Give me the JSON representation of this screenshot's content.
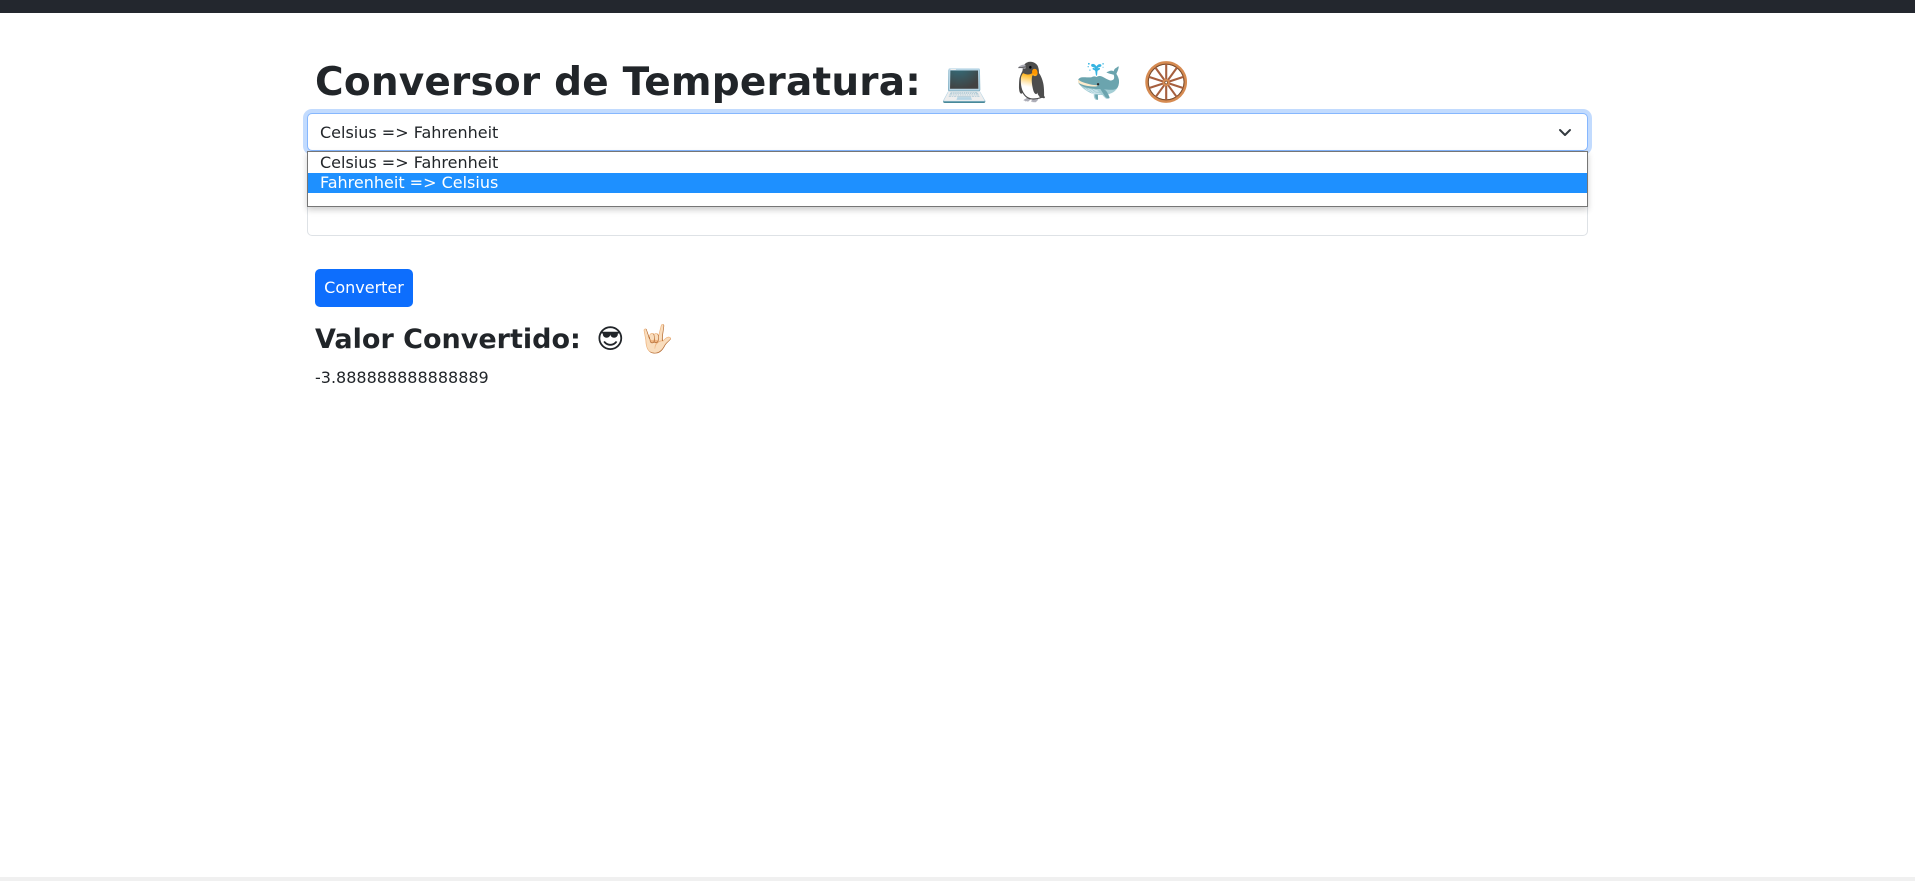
{
  "header": {
    "title": "Conversor de Temperatura:",
    "emojis": [
      "💻",
      "🐧",
      "🐳",
      "🛞"
    ]
  },
  "converter": {
    "select": {
      "value": "Celsius => Fahrenheit",
      "options": [
        "Celsius => Fahrenheit",
        "Fahrenheit => Celsius"
      ],
      "highlighted_option": "Fahrenheit => Celsius"
    },
    "input": {
      "value": "",
      "placeholder": ""
    },
    "button_label": "Converter"
  },
  "result": {
    "title": "Valor Convertido:",
    "emojis": [
      "😎",
      "🤟🏻"
    ],
    "value": "-3.888888888888889"
  },
  "colors": {
    "primary": "#0d6efd",
    "option_highlight": "#1e90ff",
    "topbar": "#23272e"
  }
}
